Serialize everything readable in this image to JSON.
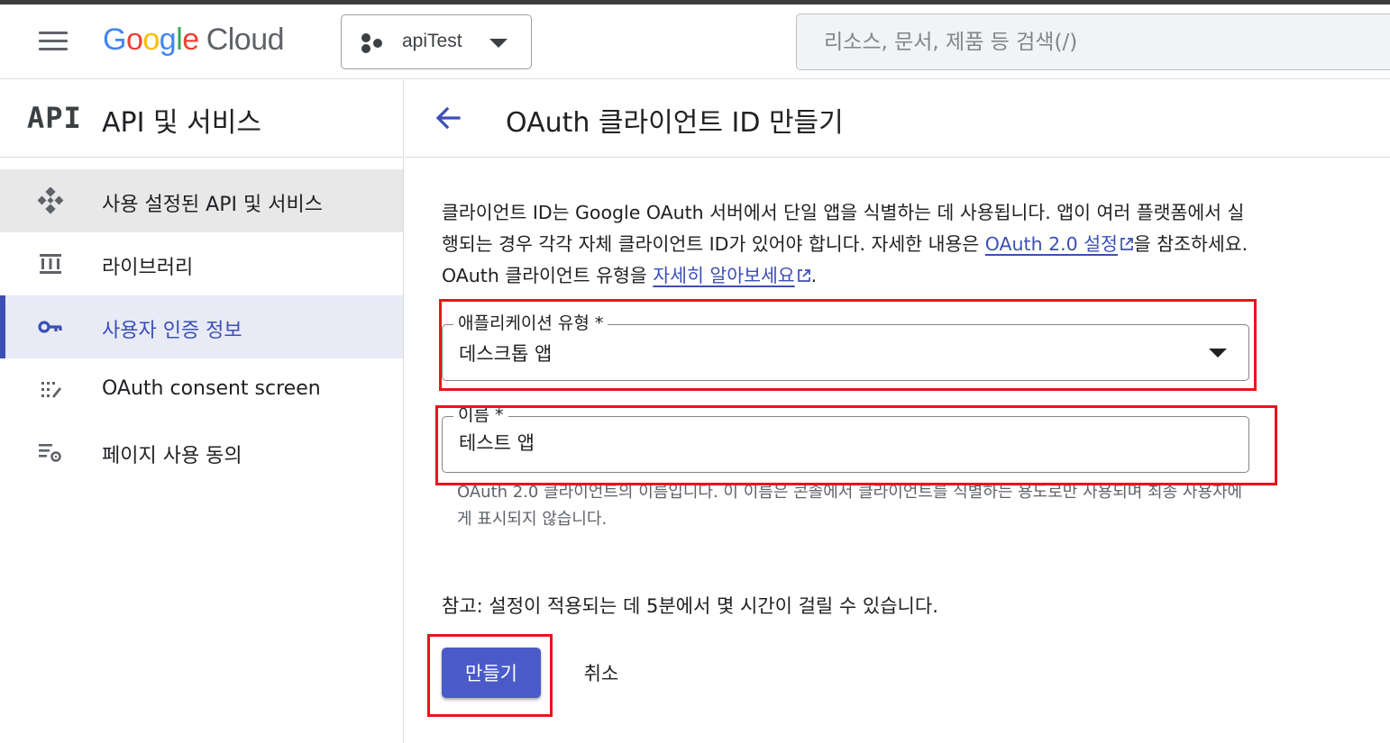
{
  "header": {
    "logo_google": [
      "G",
      "o",
      "o",
      "g",
      "l",
      "e"
    ],
    "logo_cloud": "Cloud",
    "project_name": "apiTest",
    "search_placeholder": "리소스, 문서, 제품 등 검색(/)"
  },
  "sidebar": {
    "badge": "API",
    "title": "API 및 서비스",
    "items": [
      {
        "label": "사용 설정된 API 및 서비스",
        "icon": "api-diamond-icon"
      },
      {
        "label": "라이브러리",
        "icon": "library-icon"
      },
      {
        "label": "사용자 인증 정보",
        "icon": "key-icon"
      },
      {
        "label": "OAuth consent screen",
        "icon": "consent-icon"
      },
      {
        "label": "페이지 사용 동의",
        "icon": "settings-list-icon"
      }
    ]
  },
  "main": {
    "title": "OAuth 클라이언트 ID 만들기",
    "description": {
      "part1": "클라이언트 ID는 Google OAuth 서버에서 단일 앱을 식별하는 데 사용됩니다. 앱이 여러 플랫폼에서 실행되는 경우 각각 자체 클라이언트 ID가 있어야 합니다. 자세한 내용은 ",
      "link1": "OAuth 2.0 설정",
      "part2": "을 참조하세요. OAuth 클라이언트 유형을 ",
      "link2": "자세히 알아보세요",
      "part3": "."
    },
    "app_type": {
      "label": "애플리케이션 유형 *",
      "value": "데스크톱 앱"
    },
    "name": {
      "label": "이름 *",
      "value": "테스트 앱"
    },
    "name_hint": "OAuth 2.0 클라이언트의 이름입니다. 이 이름은 콘솔에서 클라이언트를 식별하는 용도로만 사용되며 최종 사용자에게 표시되지 않습니다.",
    "note": "참고: 설정이 적용되는 데 5분에서 몇 시간이 걸릴 수 있습니다.",
    "create_button": "만들기",
    "cancel_button": "취소"
  },
  "colors": {
    "accent": "#3c4fb5",
    "button": "#4a5bc9",
    "highlight": "#e8141b"
  }
}
